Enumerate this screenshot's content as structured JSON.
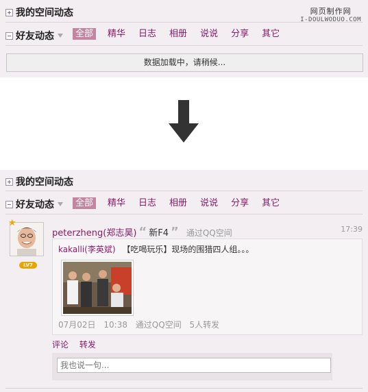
{
  "top": {
    "title": "我的空间动态",
    "feed_title": "好友动态",
    "tabs": [
      "全部",
      "精华",
      "日志",
      "相册",
      "说说",
      "分享",
      "其它"
    ],
    "loading_text": "数据加载中，请稍候..."
  },
  "watermark": {
    "line1": "网页制作网",
    "line2": "I-DOULWODUO.COM"
  },
  "arrow_icon": "down-arrow-icon",
  "bottom": {
    "title": "我的空间动态",
    "feed_title": "好友动态",
    "tabs": [
      "全部",
      "精华",
      "日志",
      "相册",
      "说说",
      "分享",
      "其它"
    ]
  },
  "feed_item": {
    "author": "peterzheng(郑志昊)",
    "title": "新F4",
    "via": "通过QQ空间",
    "time": "17:39",
    "level": "LV7",
    "forward": {
      "author": "kakalli(李英斌)",
      "text": "【吃喝玩乐】现场的围猎四人组。。。",
      "date": "07月02日",
      "clock": "10:38",
      "via": "通过QQ空间",
      "reposts": "5人转发"
    },
    "actions": {
      "comment": "评论",
      "repost": "转发"
    },
    "comment_placeholder": "我也说一句..."
  },
  "colors": {
    "accent": "#8b1a68",
    "panel_bg": "#f3eef1",
    "active_tab_bg": "#c3859f"
  }
}
